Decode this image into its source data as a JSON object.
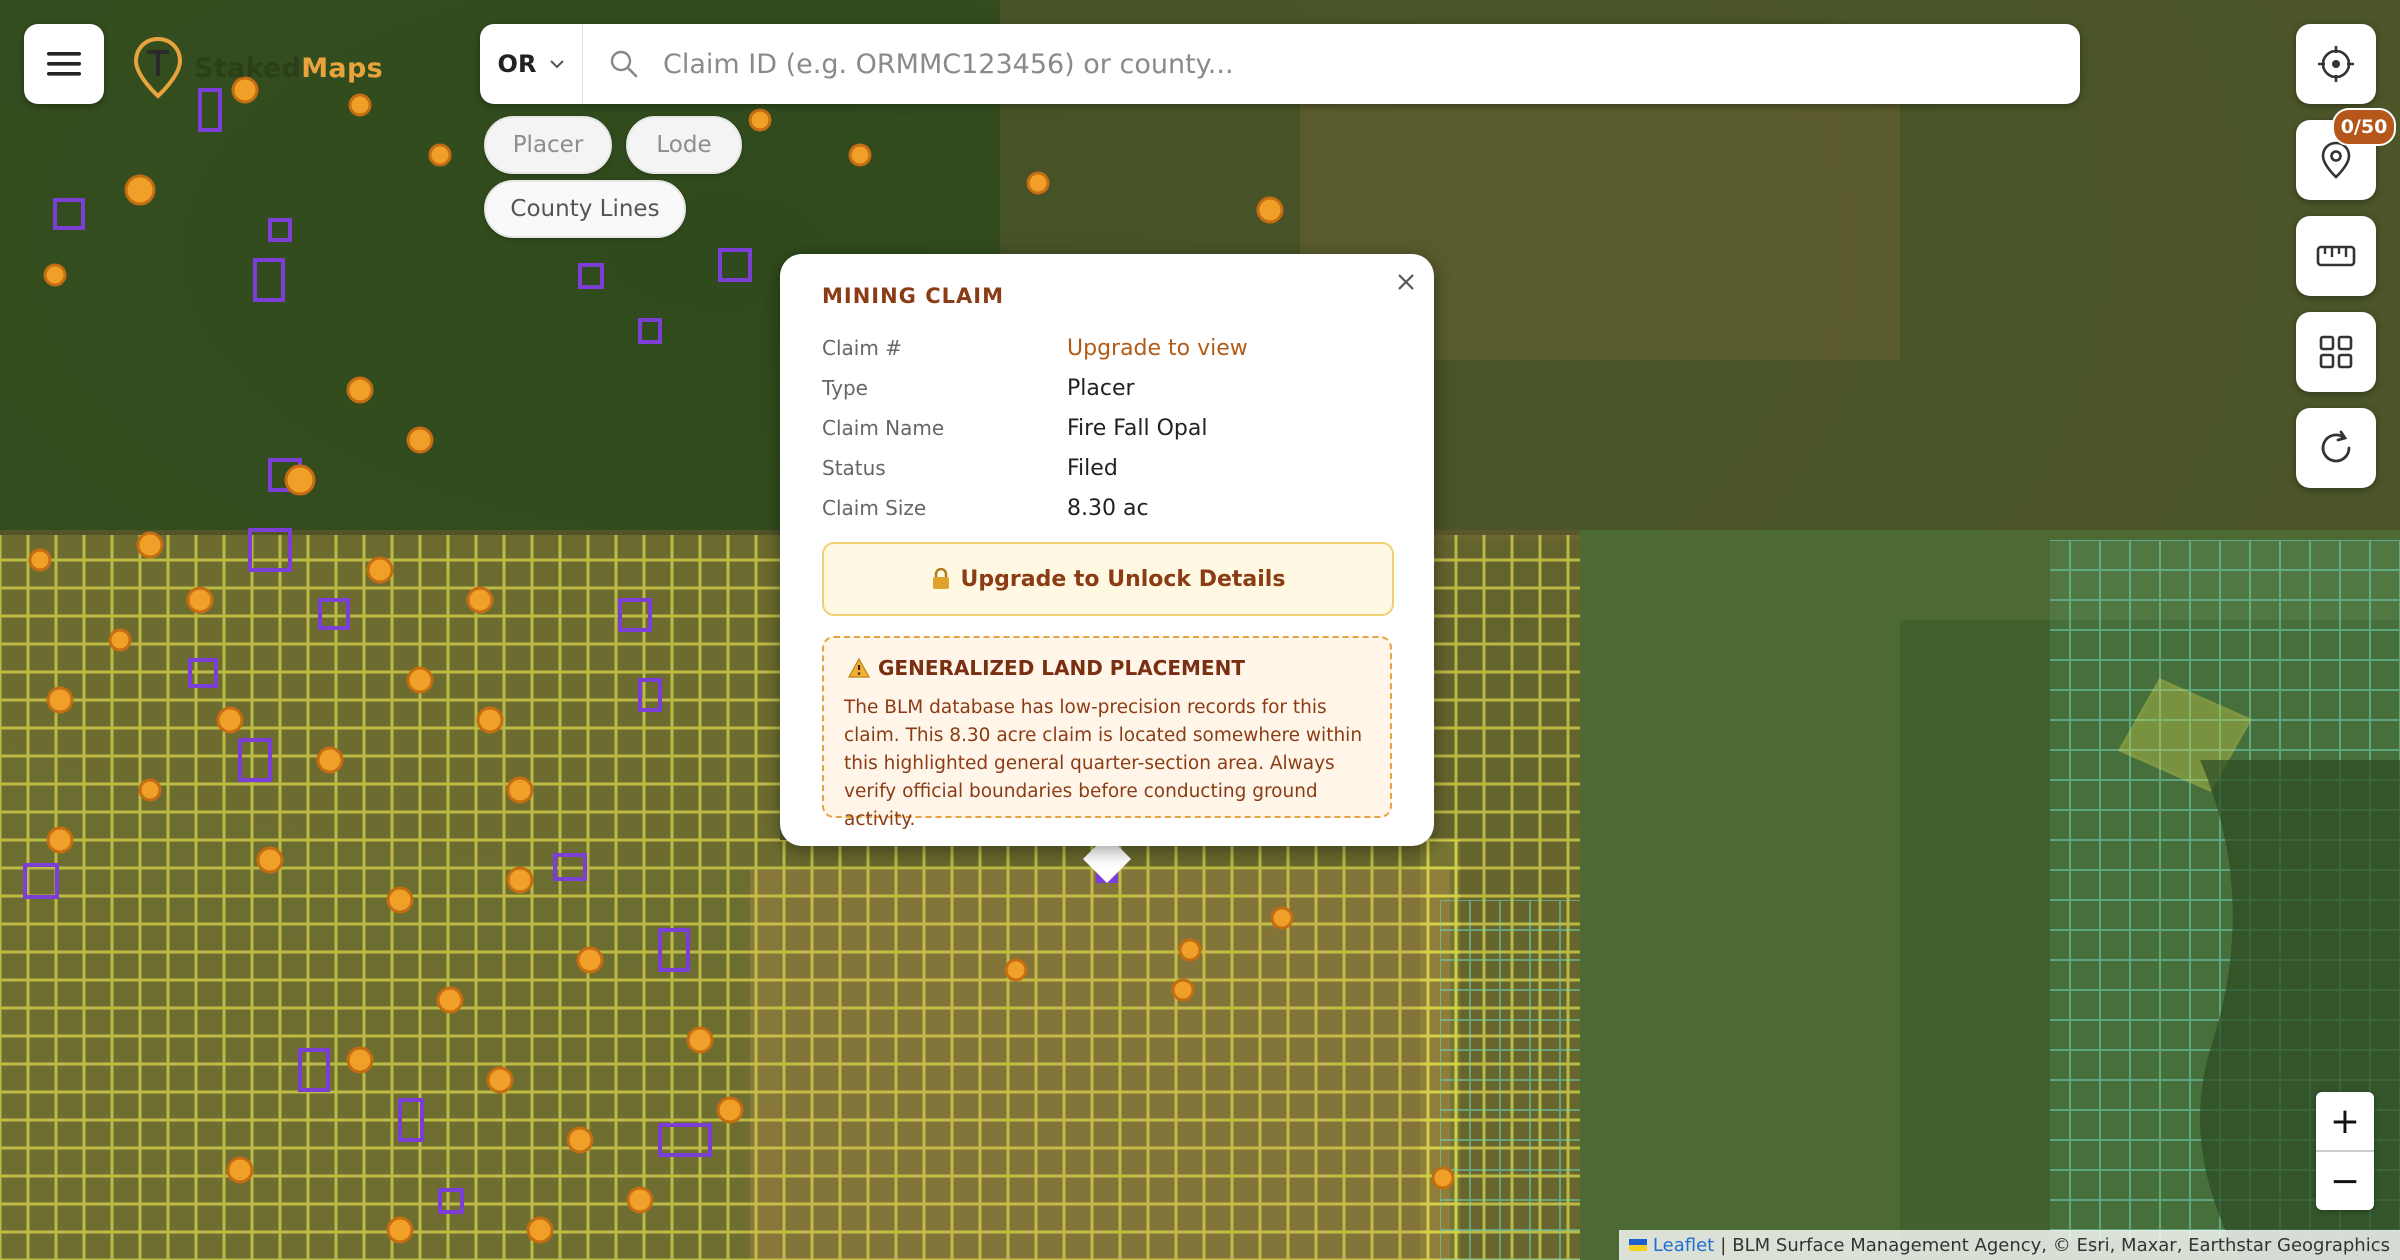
{
  "app": {
    "brand_part1": "Staked",
    "brand_part2": "Maps"
  },
  "search": {
    "state": "OR",
    "placeholder": "Claim ID (e.g. ORMMC123456) or county..."
  },
  "filters": {
    "placer": "Placer",
    "lode": "Lode",
    "county_lines": "County Lines"
  },
  "tools": {
    "icons": [
      "locate-icon",
      "pin-icon",
      "ruler-icon",
      "grid-icon",
      "refresh-icon"
    ],
    "saved_badge": "0/50"
  },
  "popup": {
    "title": "MINING CLAIM",
    "rows": [
      {
        "label": "Claim #",
        "value": "Upgrade to view"
      },
      {
        "label": "Type",
        "value": "Placer"
      },
      {
        "label": "Claim Name",
        "value": "Fire Fall Opal"
      },
      {
        "label": "Status",
        "value": "Filed"
      },
      {
        "label": "Claim Size",
        "value": "8.30 ac"
      }
    ],
    "unlock_label": "Upgrade to Unlock Details",
    "warning_title": "GENERALIZED LAND PLACEMENT",
    "warning_text": "The BLM database has low-precision records for this claim. This 8.30 acre claim is located somewhere within this highlighted general quarter-section area. Always verify official boundaries before conducting ground activity."
  },
  "zoom": {
    "in": "+",
    "out": "−"
  },
  "attribution": {
    "leaflet": "Leaflet",
    "sep": "|",
    "text": "BLM Surface Management Agency, © Esri, Maxar, Earthstar Geographics"
  },
  "colors": {
    "accent": "#b05b17",
    "badge": "#b5561a",
    "claim_purple": "#7b3fd6",
    "claim_orange": "#f0a028"
  }
}
